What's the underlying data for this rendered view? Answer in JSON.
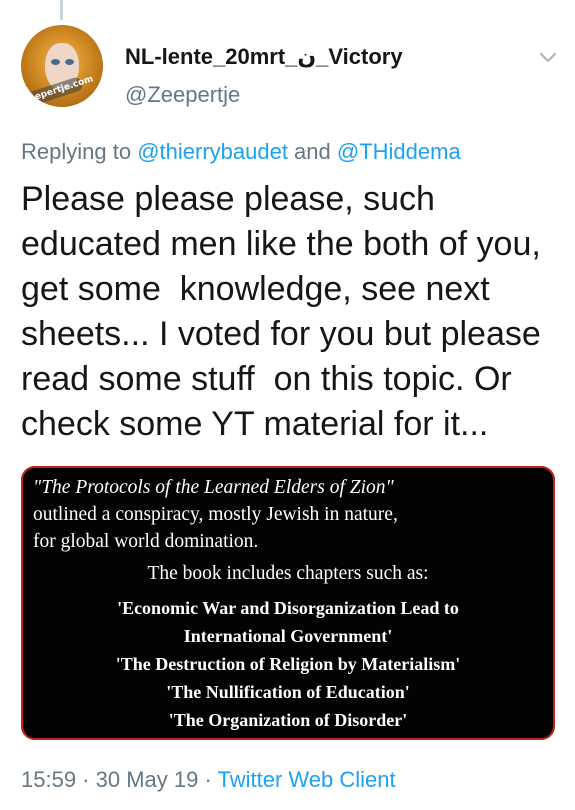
{
  "tweet": {
    "display_name": "NL-lente_20mrt_ن_Victory",
    "handle": "@Zeepertje",
    "avatar_text": "zeepertje.com",
    "reply": {
      "prefix": "Replying to ",
      "mention1": "@thierrybaudet",
      "and": " and ",
      "mention2": "@THiddema"
    },
    "text": "Please please please, such\neducated men like the both of you,\nget some  knowledge, see next\nsheets... I voted for you but please\nread some stuff  on this topic. Or\ncheck some YT material for it...",
    "media": {
      "quote_title": "\"The Protocols of the Learned Elders of Zion\"",
      "intro_rest": "outlined a conspiracy, mostly Jewish in nature,\nfor global world domination.",
      "book_line": "The book includes chapters such as:",
      "chapters": [
        "'Economic War and Disorganization Lead to",
        "International Government'",
        "'The Destruction of Religion by Materialism'",
        "'The Nullification of Education'",
        "'The Organization of Disorder'"
      ]
    },
    "time": "15:59",
    "sep1": " · ",
    "date": "30 May 19",
    "sep2": " · ",
    "client": "Twitter Web Client"
  },
  "colors": {
    "link": "#1da1f2",
    "secondary": "#657786",
    "text": "#14171a",
    "media_border": "#c3201e"
  },
  "icons": {
    "menu": "chevron-down-icon"
  }
}
